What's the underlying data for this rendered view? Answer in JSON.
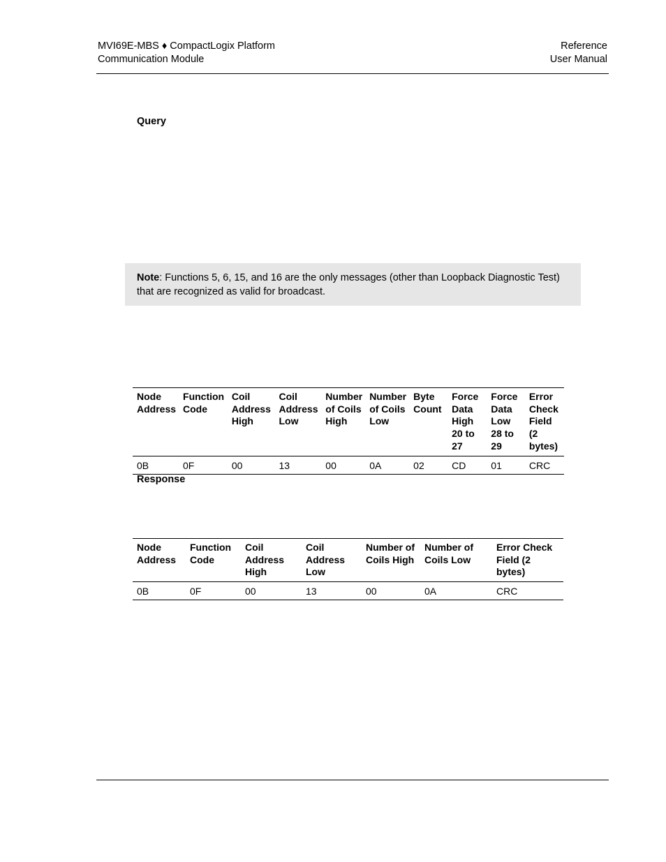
{
  "header": {
    "left_line1": "MVI69E-MBS ♦ CompactLogix Platform",
    "left_line2": "Communication Module",
    "right_line1": "Reference",
    "right_line2": "User Manual"
  },
  "query_heading": "Query",
  "note": {
    "label": "Note",
    "text": ": Functions 5, 6, 15, and 16 are the only messages (other than Loopback Diagnostic Test) that are recognized as valid for broadcast."
  },
  "query_table": {
    "headers": [
      "Node Address",
      "Function Code",
      "Coil Address High",
      "Coil Address Low",
      "Number of Coils High",
      "Number of Coils Low",
      "Byte Count",
      "Force Data High 20 to 27",
      "Force Data Low 28 to 29",
      "Error Check Field (2 bytes)"
    ],
    "rows": [
      [
        "0B",
        "0F",
        "00",
        "13",
        "00",
        "0A",
        "02",
        "CD",
        "01",
        "CRC"
      ]
    ]
  },
  "response_heading": "Response",
  "response_table": {
    "headers": [
      "Node Address",
      "Function Code",
      "Coil Address High",
      "Coil Address Low",
      "Number of Coils High",
      "Number of Coils Low",
      "Error Check Field (2 bytes)"
    ],
    "rows": [
      [
        "0B",
        "0F",
        "00",
        "13",
        "00",
        "0A",
        "CRC"
      ]
    ]
  }
}
